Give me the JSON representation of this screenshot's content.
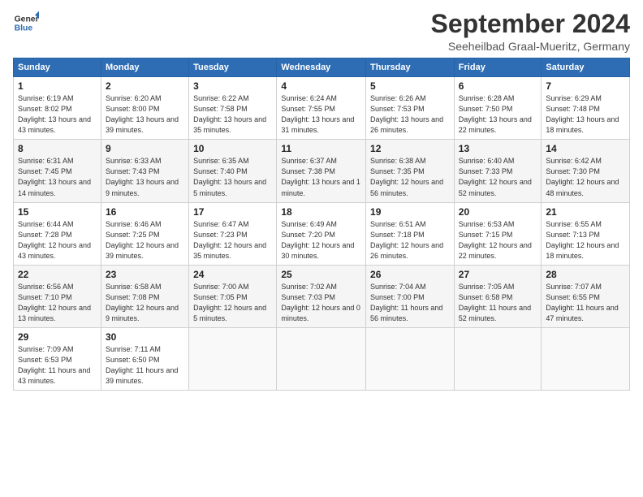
{
  "header": {
    "logo_line1": "General",
    "logo_line2": "Blue",
    "month": "September 2024",
    "location": "Seeheilbad Graal-Mueritz, Germany"
  },
  "weekdays": [
    "Sunday",
    "Monday",
    "Tuesday",
    "Wednesday",
    "Thursday",
    "Friday",
    "Saturday"
  ],
  "weeks": [
    [
      {
        "day": "1",
        "sunrise": "6:19 AM",
        "sunset": "8:02 PM",
        "daylight": "13 hours and 43 minutes."
      },
      {
        "day": "2",
        "sunrise": "6:20 AM",
        "sunset": "8:00 PM",
        "daylight": "13 hours and 39 minutes."
      },
      {
        "day": "3",
        "sunrise": "6:22 AM",
        "sunset": "7:58 PM",
        "daylight": "13 hours and 35 minutes."
      },
      {
        "day": "4",
        "sunrise": "6:24 AM",
        "sunset": "7:55 PM",
        "daylight": "13 hours and 31 minutes."
      },
      {
        "day": "5",
        "sunrise": "6:26 AM",
        "sunset": "7:53 PM",
        "daylight": "13 hours and 26 minutes."
      },
      {
        "day": "6",
        "sunrise": "6:28 AM",
        "sunset": "7:50 PM",
        "daylight": "13 hours and 22 minutes."
      },
      {
        "day": "7",
        "sunrise": "6:29 AM",
        "sunset": "7:48 PM",
        "daylight": "13 hours and 18 minutes."
      }
    ],
    [
      {
        "day": "8",
        "sunrise": "6:31 AM",
        "sunset": "7:45 PM",
        "daylight": "13 hours and 14 minutes."
      },
      {
        "day": "9",
        "sunrise": "6:33 AM",
        "sunset": "7:43 PM",
        "daylight": "13 hours and 9 minutes."
      },
      {
        "day": "10",
        "sunrise": "6:35 AM",
        "sunset": "7:40 PM",
        "daylight": "13 hours and 5 minutes."
      },
      {
        "day": "11",
        "sunrise": "6:37 AM",
        "sunset": "7:38 PM",
        "daylight": "13 hours and 1 minute."
      },
      {
        "day": "12",
        "sunrise": "6:38 AM",
        "sunset": "7:35 PM",
        "daylight": "12 hours and 56 minutes."
      },
      {
        "day": "13",
        "sunrise": "6:40 AM",
        "sunset": "7:33 PM",
        "daylight": "12 hours and 52 minutes."
      },
      {
        "day": "14",
        "sunrise": "6:42 AM",
        "sunset": "7:30 PM",
        "daylight": "12 hours and 48 minutes."
      }
    ],
    [
      {
        "day": "15",
        "sunrise": "6:44 AM",
        "sunset": "7:28 PM",
        "daylight": "12 hours and 43 minutes."
      },
      {
        "day": "16",
        "sunrise": "6:46 AM",
        "sunset": "7:25 PM",
        "daylight": "12 hours and 39 minutes."
      },
      {
        "day": "17",
        "sunrise": "6:47 AM",
        "sunset": "7:23 PM",
        "daylight": "12 hours and 35 minutes."
      },
      {
        "day": "18",
        "sunrise": "6:49 AM",
        "sunset": "7:20 PM",
        "daylight": "12 hours and 30 minutes."
      },
      {
        "day": "19",
        "sunrise": "6:51 AM",
        "sunset": "7:18 PM",
        "daylight": "12 hours and 26 minutes."
      },
      {
        "day": "20",
        "sunrise": "6:53 AM",
        "sunset": "7:15 PM",
        "daylight": "12 hours and 22 minutes."
      },
      {
        "day": "21",
        "sunrise": "6:55 AM",
        "sunset": "7:13 PM",
        "daylight": "12 hours and 18 minutes."
      }
    ],
    [
      {
        "day": "22",
        "sunrise": "6:56 AM",
        "sunset": "7:10 PM",
        "daylight": "12 hours and 13 minutes."
      },
      {
        "day": "23",
        "sunrise": "6:58 AM",
        "sunset": "7:08 PM",
        "daylight": "12 hours and 9 minutes."
      },
      {
        "day": "24",
        "sunrise": "7:00 AM",
        "sunset": "7:05 PM",
        "daylight": "12 hours and 5 minutes."
      },
      {
        "day": "25",
        "sunrise": "7:02 AM",
        "sunset": "7:03 PM",
        "daylight": "12 hours and 0 minutes."
      },
      {
        "day": "26",
        "sunrise": "7:04 AM",
        "sunset": "7:00 PM",
        "daylight": "11 hours and 56 minutes."
      },
      {
        "day": "27",
        "sunrise": "7:05 AM",
        "sunset": "6:58 PM",
        "daylight": "11 hours and 52 minutes."
      },
      {
        "day": "28",
        "sunrise": "7:07 AM",
        "sunset": "6:55 PM",
        "daylight": "11 hours and 47 minutes."
      }
    ],
    [
      {
        "day": "29",
        "sunrise": "7:09 AM",
        "sunset": "6:53 PM",
        "daylight": "11 hours and 43 minutes."
      },
      {
        "day": "30",
        "sunrise": "7:11 AM",
        "sunset": "6:50 PM",
        "daylight": "11 hours and 39 minutes."
      },
      null,
      null,
      null,
      null,
      null
    ]
  ]
}
